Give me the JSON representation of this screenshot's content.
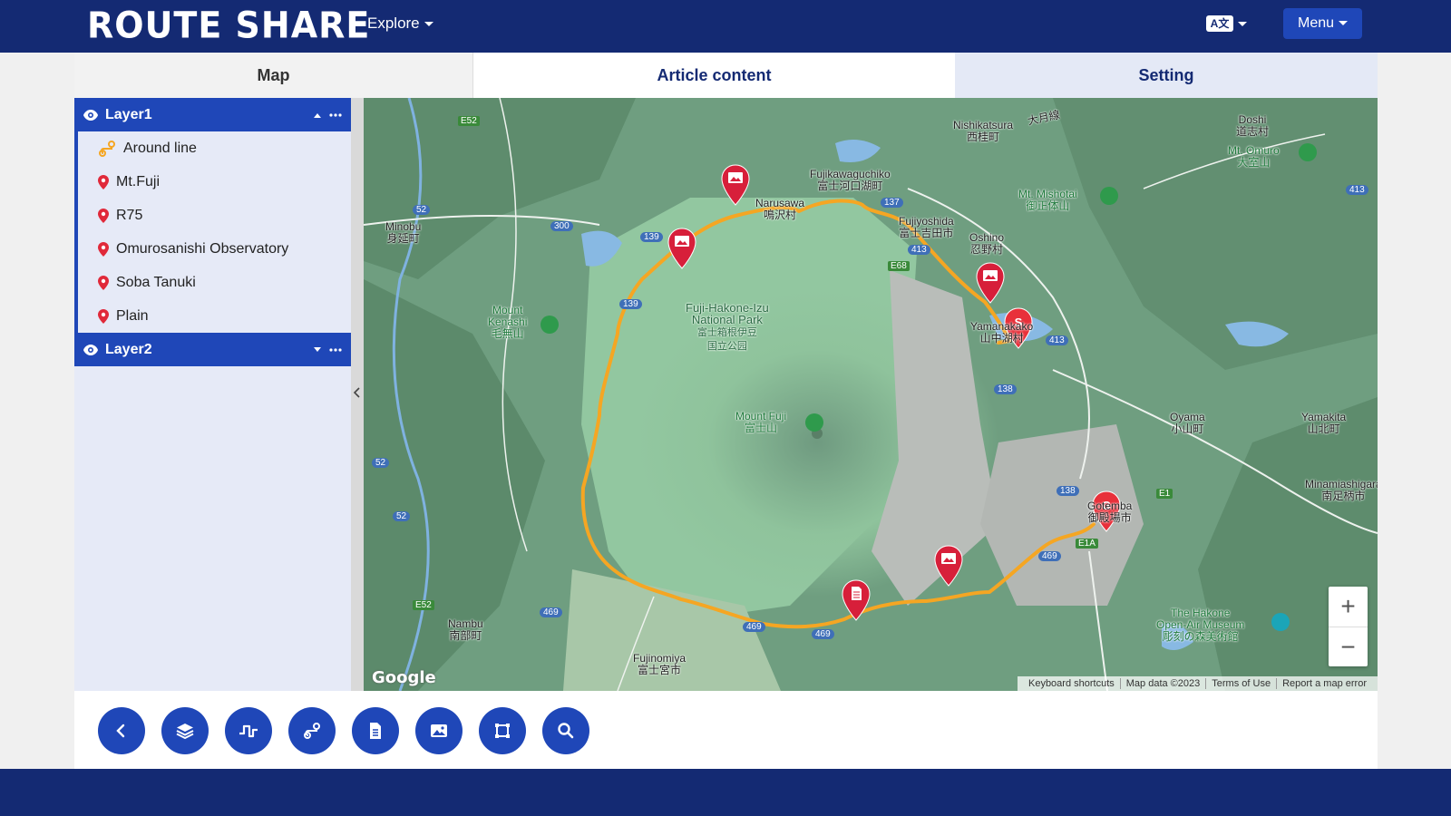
{
  "header": {
    "logo": "ROUTE SHARE",
    "explore_label": "Explore",
    "lang_label": "A文",
    "menu_label": "Menu"
  },
  "tabs": [
    {
      "label": "Map"
    },
    {
      "label": "Article content"
    },
    {
      "label": "Setting"
    }
  ],
  "sidebar": {
    "layers": [
      {
        "name": "Layer1",
        "items": [
          {
            "label": "Around line",
            "icon": "route-icon"
          },
          {
            "label": "Mt.Fuji",
            "icon": "map-pin-icon"
          },
          {
            "label": "R75",
            "icon": "map-pin-icon"
          },
          {
            "label": "Omurosanishi Observatory",
            "icon": "map-pin-icon"
          },
          {
            "label": "Soba Tanuki",
            "icon": "map-pin-icon"
          },
          {
            "label": "Plain",
            "icon": "map-pin-icon"
          }
        ]
      },
      {
        "name": "Layer2",
        "items": []
      }
    ]
  },
  "map": {
    "labels": {
      "nishikatsura": "Nishikatsura",
      "nishikatsura_jp": "西桂町",
      "otsuki": "大月線",
      "doshi": "Doshi",
      "doshi_jp": "道志村",
      "mt_omuro": "Mt. Omuro",
      "mt_omuro_jp": "大室山",
      "fujikawaguchiko": "Fujikawaguchiko",
      "fujikawaguchiko_jp": "富士河口湖町",
      "mt_mishotai": "Mt. Mishotai",
      "mt_mishotai_jp": "御正体山",
      "narusawa": "Narusawa",
      "narusawa_jp": "鳴沢村",
      "fujiyoshida": "Fujiyoshida",
      "fujiyoshida_jp": "富士吉田市",
      "oshino": "Oshino",
      "oshino_jp": "忍野村",
      "minobu": "Minobu",
      "minobu_jp": "身延町",
      "park_1": "Fuji-Hakone-Izu",
      "park_2": "National Park",
      "park_jp_1": "富士箱根伊豆",
      "park_jp_2": "国立公园",
      "mount_kenashi_1": "Mount",
      "mount_kenashi_2": "Kenashi",
      "mount_kenashi_jp": "毛無山",
      "yamanakako": "Yamanakako",
      "yamanakako_jp": "山中湖村",
      "mount_fuji": "Mount Fuji",
      "mount_fuji_jp": "富士山",
      "oyama": "Oyama",
      "oyama_jp": "小山町",
      "yamakita": "Yamakita",
      "yamakita_jp": "山北町",
      "gotemba": "Gotemba",
      "gotemba_jp": "御殿場市",
      "minamiashigara": "Minamiashigara",
      "minamiashigara_jp": "南足柄市",
      "hakone_1": "The Hakone",
      "hakone_2": "Open-Air Museum",
      "hakone_jp": "彫刻の森美術館",
      "nambu": "Nambu",
      "nambu_jp": "南部町",
      "fujinomiya": "Fujinomiya",
      "fujinomiya_jp": "富士宮市"
    },
    "road_badges": [
      "E52",
      "52",
      "300",
      "139",
      "139",
      "137",
      "413",
      "413",
      "E68",
      "138",
      "413",
      "138",
      "E1",
      "E1A",
      "52",
      "52",
      "E52",
      "469",
      "469",
      "469",
      "469"
    ],
    "start_marker": "S",
    "goal_marker": "G",
    "google_logo": "Google",
    "zoom_in": "+",
    "zoom_out": "−",
    "attribution": [
      "Keyboard shortcuts",
      "Map data ©2023",
      "Terms of Use",
      "Report a map error"
    ]
  },
  "toolbar": {
    "buttons": [
      {
        "icon": "back-icon"
      },
      {
        "icon": "layers-icon"
      },
      {
        "icon": "elevation-icon"
      },
      {
        "icon": "route-icon"
      },
      {
        "icon": "document-icon"
      },
      {
        "icon": "image-icon"
      },
      {
        "icon": "crop-icon"
      },
      {
        "icon": "search-icon"
      }
    ]
  },
  "colors": {
    "header": "#142a73",
    "accent": "#1f47b8",
    "route": "#f5a623",
    "pin": "#e0293a"
  }
}
